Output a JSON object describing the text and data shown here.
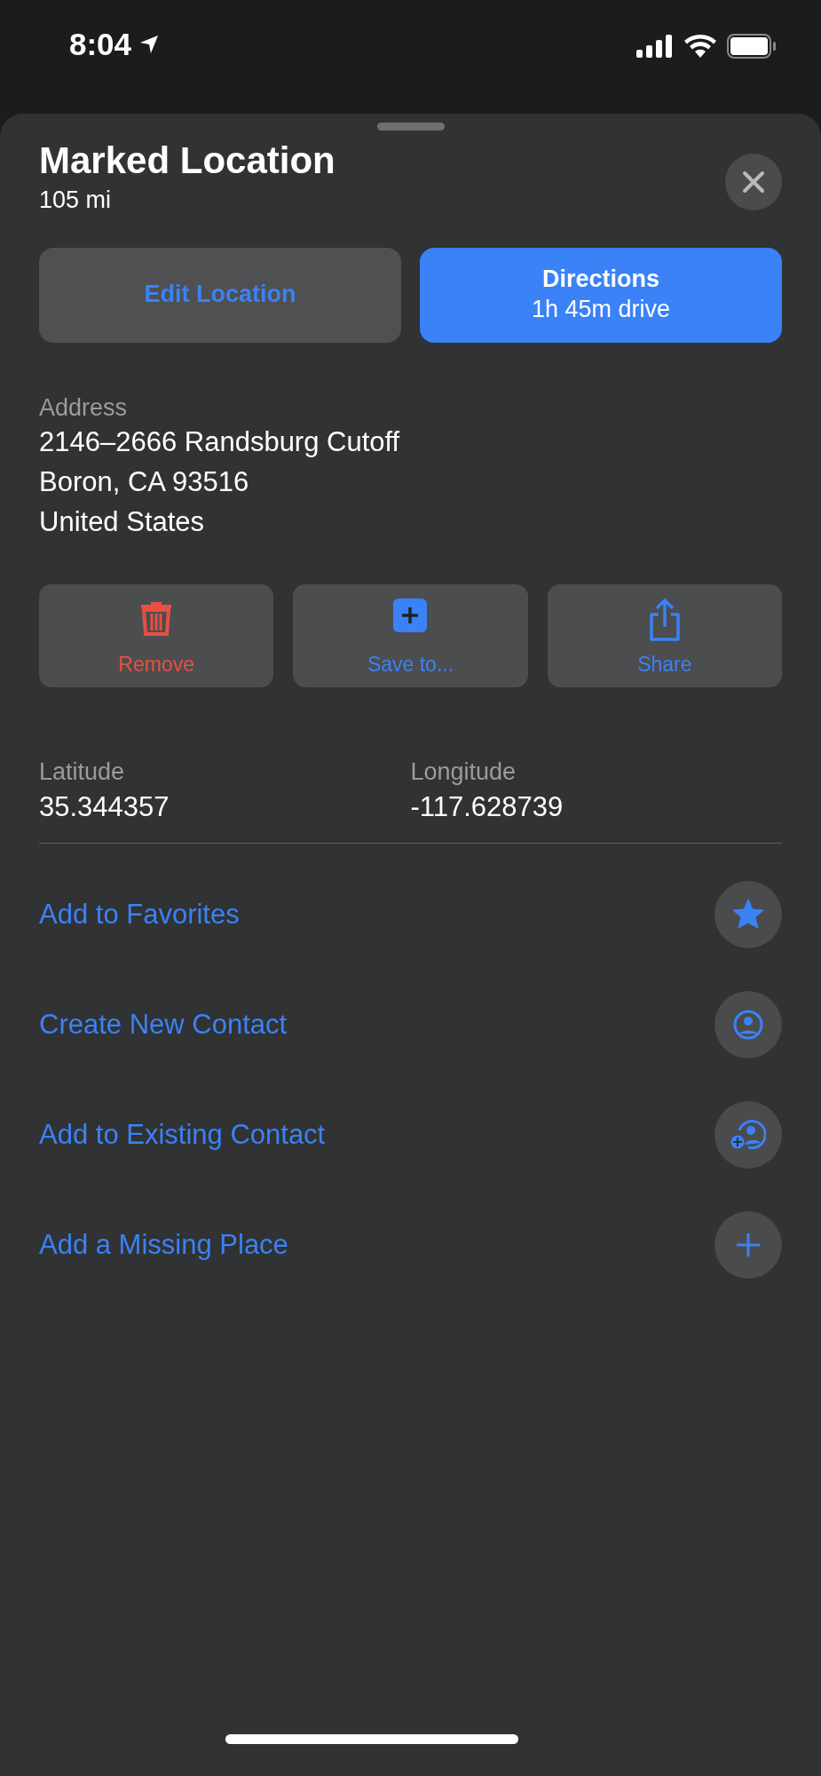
{
  "status_bar": {
    "time": "8:04"
  },
  "sheet": {
    "title": "Marked Location",
    "distance": "105 mi"
  },
  "primary_buttons": [
    {
      "kind": "plain",
      "label": "Edit Location"
    },
    {
      "kind": "accent",
      "label": "Directions",
      "detail": "1h 45m drive"
    }
  ],
  "address": {
    "label": "Address",
    "lines": [
      "2146–2666 Randsburg Cutoff",
      "Boron, CA  93516",
      "United States"
    ]
  },
  "actions": [
    {
      "kind": "remove",
      "label": "Remove"
    },
    {
      "kind": "save",
      "label": "Save to..."
    },
    {
      "kind": "share",
      "label": "Share"
    }
  ],
  "coordinates": [
    {
      "label": "Latitude",
      "value": "35.344357"
    },
    {
      "label": "Longitude",
      "value": "-117.628739"
    }
  ],
  "rows": [
    {
      "kind": "favorite",
      "label": "Add to Favorites"
    },
    {
      "kind": "contact",
      "label": "Create New Contact"
    },
    {
      "kind": "addcontact",
      "label": "Add to Existing Contact"
    },
    {
      "kind": "place",
      "label": "Add a Missing Place"
    }
  ]
}
